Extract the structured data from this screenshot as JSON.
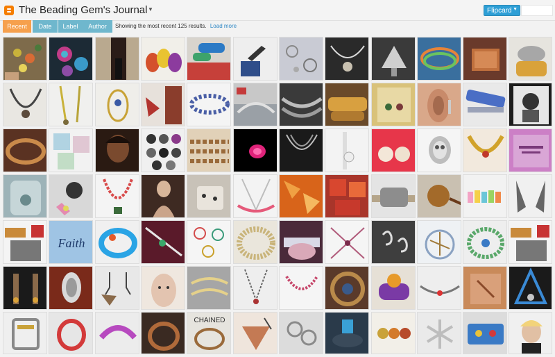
{
  "header": {
    "blog_title": "The Beading Gem's Journal",
    "view_label": "Flipcard",
    "blogger_icon": "blogger-icon",
    "caret_icon": "caret-down-icon"
  },
  "tabs": [
    {
      "label": "Recent",
      "active": true
    },
    {
      "label": "Date",
      "active": false
    },
    {
      "label": "Label",
      "active": false
    },
    {
      "label": "Author",
      "active": false
    }
  ],
  "results": {
    "text": "Showing the most recent 125 results.",
    "load_more": "Load more"
  },
  "colors": {
    "accent_orange": "#f6a04d",
    "tab_blue": "#6fb7cd",
    "link_blue": "#2f88c5",
    "view_button_blue": "#2e9fd6"
  },
  "tile_images": [
    {
      "text": ""
    },
    {
      "text": ""
    },
    {
      "text": ""
    },
    {
      "text": ""
    },
    {
      "text": ""
    },
    {
      "text": ""
    },
    {
      "text": ""
    },
    {
      "text": ""
    },
    {
      "text": ""
    },
    {
      "text": ""
    },
    {
      "text": ""
    },
    {
      "text": ""
    },
    {
      "text": "Faith"
    },
    {
      "text": "CHAINED"
    }
  ]
}
